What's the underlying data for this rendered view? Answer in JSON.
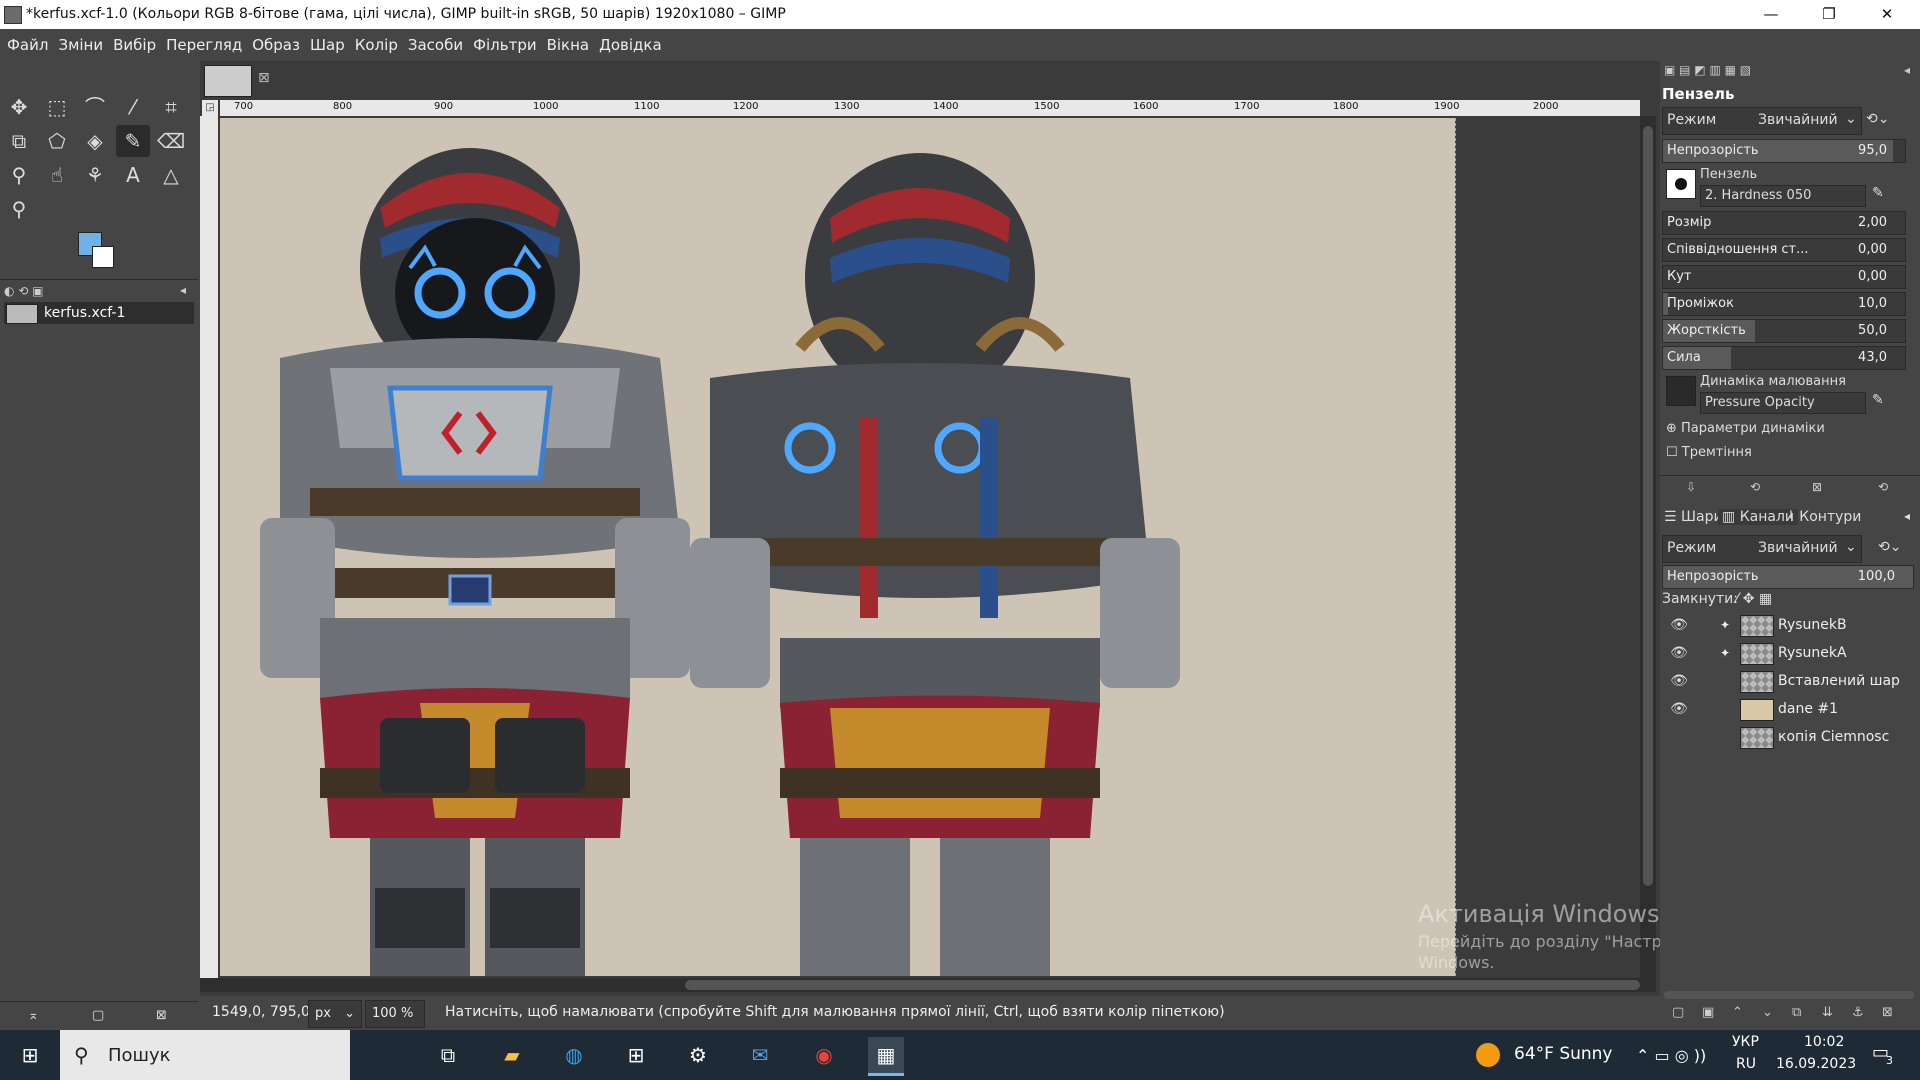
{
  "window": {
    "title": "*kerfus.xcf-1.0 (Кольори RGB 8-бітове (гама, цілі числа), GIMP built-in sRGB, 50 шарів) 1920x1080 – GIMP",
    "minimize": "—",
    "maximize": "❐",
    "close": "✕"
  },
  "menu": [
    "Файл",
    "Зміни",
    "Вибір",
    "Перегляд",
    "Образ",
    "Шар",
    "Колір",
    "Засоби",
    "Фільтри",
    "Вікна",
    "Довідка"
  ],
  "images_panel": {
    "image_name": "kerfus.xcf-1"
  },
  "ruler": {
    "ticks": [
      "700",
      "800",
      "900",
      "1000",
      "1100",
      "1200",
      "1300",
      "1400",
      "1500",
      "1600",
      "1700",
      "1800",
      "1900",
      "2000"
    ]
  },
  "status": {
    "coords": "1549,0, 795,0",
    "unit": "px",
    "zoom": "100 %",
    "message": "Натисніть, щоб намалювати (спробуйте Shift для малювання прямої лінії, Ctrl, щоб взяти колір піпеткою)"
  },
  "tool_options": {
    "title": "Пензель",
    "mode_label": "Режим",
    "mode_value": "Звичайний",
    "opacity_label": "Непрозорість",
    "opacity_value": "95,0",
    "opacity_fraction": 0.95,
    "brush_label": "Пензель",
    "brush_value": "2. Hardness 050",
    "params": [
      {
        "label": "Розмір",
        "value": "2,00"
      },
      {
        "label": "Співвідношення ст...",
        "value": "0,00"
      },
      {
        "label": "Кут",
        "value": "0,00"
      },
      {
        "label": "Проміжок",
        "value": "10,0"
      },
      {
        "label": "Жорсткість",
        "value": "50,0"
      },
      {
        "label": "Сила",
        "value": "43,0"
      }
    ],
    "dynamics_label": "Динаміка малювання",
    "dynamics_value": "Pressure Opacity",
    "dynamics_options_label": "Параметри динаміки",
    "jitter_label": "Тремтіння"
  },
  "layers_dock": {
    "tabs": [
      "Шари",
      "Канали",
      "Контури"
    ],
    "mode_label": "Режим",
    "mode_value": "Звичайний",
    "opacity_label": "Непрозорість",
    "opacity_value": "100,0",
    "lock_label": "Замкнути:",
    "layers": [
      {
        "name": "RysunekB"
      },
      {
        "name": "RysunekA"
      },
      {
        "name": "Вставлений шар"
      },
      {
        "name": "dane #1"
      },
      {
        "name": "копія Ciemnosc"
      }
    ]
  },
  "watermark": {
    "title": "Активація Windows",
    "line1": "Перейдіть до розділу \"Настройки\", щоб активувати",
    "line2": "Windows."
  },
  "taskbar": {
    "search_placeholder": "Пошук",
    "weather": "64°F  Sunny",
    "lang_top": "УКР",
    "lang_bottom": "RU",
    "time": "10:02",
    "date": "16.09.2023",
    "notif_count": "3"
  },
  "colors": {
    "foreground": "#6fb3e6",
    "background": "#ffffff",
    "canvas_bg": "#cdc4b5"
  }
}
